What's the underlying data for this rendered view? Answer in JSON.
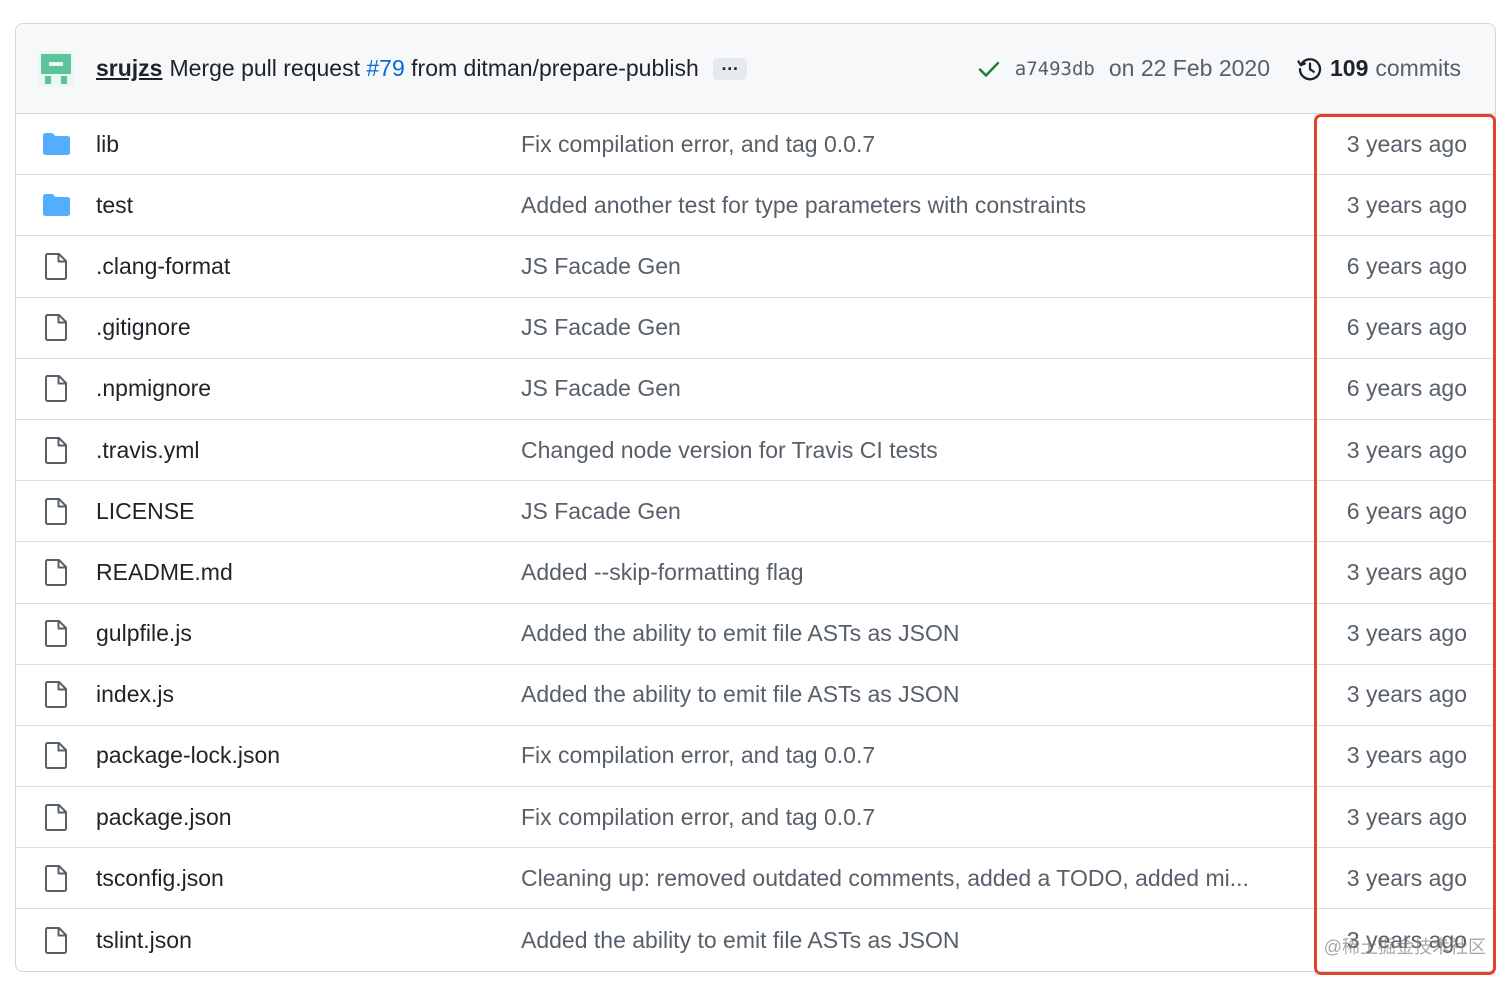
{
  "commit": {
    "author": "srujzs",
    "message_prefix": "Merge pull request",
    "pr_link": "#79",
    "message_suffix": "from ditman/prepare-publish",
    "ellipsis": "…",
    "sha": "a7493db",
    "date": "on 22 Feb 2020",
    "commits_count": "109",
    "commits_label": "commits"
  },
  "files": [
    {
      "type": "folder",
      "name": "lib",
      "message": "Fix compilation error, and tag 0.0.7",
      "age": "3 years ago"
    },
    {
      "type": "folder",
      "name": "test",
      "message": "Added another test for type parameters with constraints",
      "age": "3 years ago"
    },
    {
      "type": "file",
      "name": ".clang-format",
      "message": "JS Facade Gen",
      "age": "6 years ago"
    },
    {
      "type": "file",
      "name": ".gitignore",
      "message": "JS Facade Gen",
      "age": "6 years ago"
    },
    {
      "type": "file",
      "name": ".npmignore",
      "message": "JS Facade Gen",
      "age": "6 years ago"
    },
    {
      "type": "file",
      "name": ".travis.yml",
      "message": "Changed node version for Travis CI tests",
      "age": "3 years ago"
    },
    {
      "type": "file",
      "name": "LICENSE",
      "message": "JS Facade Gen",
      "age": "6 years ago"
    },
    {
      "type": "file",
      "name": "README.md",
      "message": "Added --skip-formatting flag",
      "age": "3 years ago"
    },
    {
      "type": "file",
      "name": "gulpfile.js",
      "message": "Added the ability to emit file ASTs as JSON",
      "age": "3 years ago"
    },
    {
      "type": "file",
      "name": "index.js",
      "message": "Added the ability to emit file ASTs as JSON",
      "age": "3 years ago"
    },
    {
      "type": "file",
      "name": "package-lock.json",
      "message": "Fix compilation error, and tag 0.0.7",
      "age": "3 years ago"
    },
    {
      "type": "file",
      "name": "package.json",
      "message": "Fix compilation error, and tag 0.0.7",
      "age": "3 years ago"
    },
    {
      "type": "file",
      "name": "tsconfig.json",
      "message": "Cleaning up: removed outdated comments, added a TODO, added mi...",
      "age": "3 years ago"
    },
    {
      "type": "file",
      "name": "tslint.json",
      "message": "Added the ability to emit file ASTs as JSON",
      "age": "3 years ago"
    }
  ],
  "watermark": "@稀土掘金技术社区",
  "colors": {
    "accent_link": "#0969da",
    "check": "#1a7f37",
    "folder": "#54aeff",
    "highlight": "#e5402f",
    "avatar": "#5dc39a"
  },
  "icons": {
    "folder": "folder-icon",
    "file": "file-icon",
    "check": "check-icon",
    "history": "history-icon",
    "avatar": "avatar-identicon"
  }
}
